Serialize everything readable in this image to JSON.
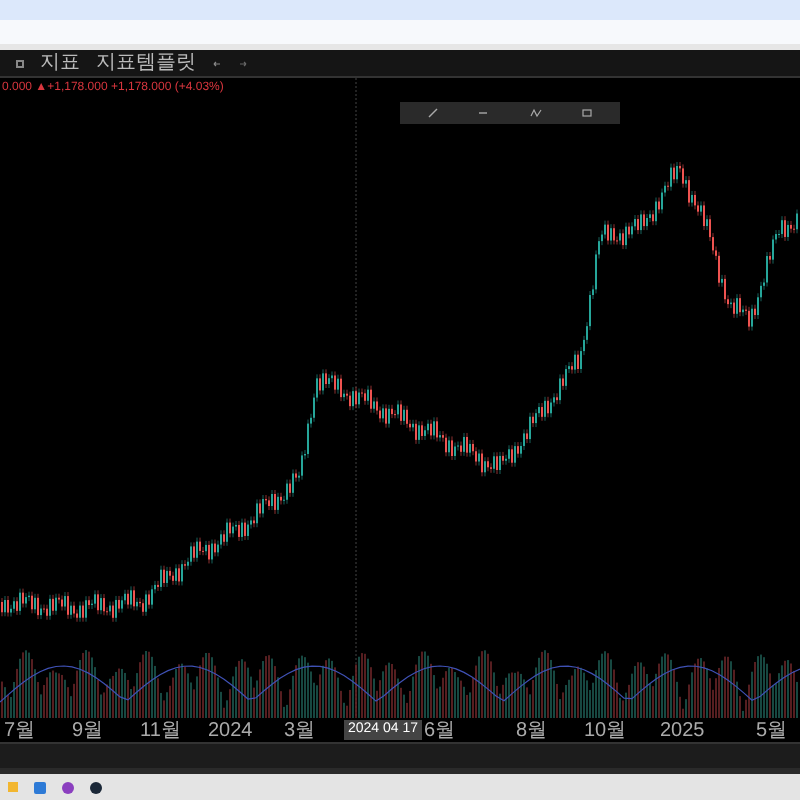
{
  "toolbar": {
    "items": [
      {
        "label": "지표"
      },
      {
        "label": "지표템플릿"
      }
    ]
  },
  "legend": "0.000 ▲+1,178.000 +1,178.000 (+4.03%)",
  "crosshair": {
    "label": "2024 04 17"
  },
  "x_axis": [
    "7월",
    "9월",
    "11월",
    "2024",
    "3월",
    "6월",
    "8월",
    "10월",
    "2025",
    "5월"
  ]
}
